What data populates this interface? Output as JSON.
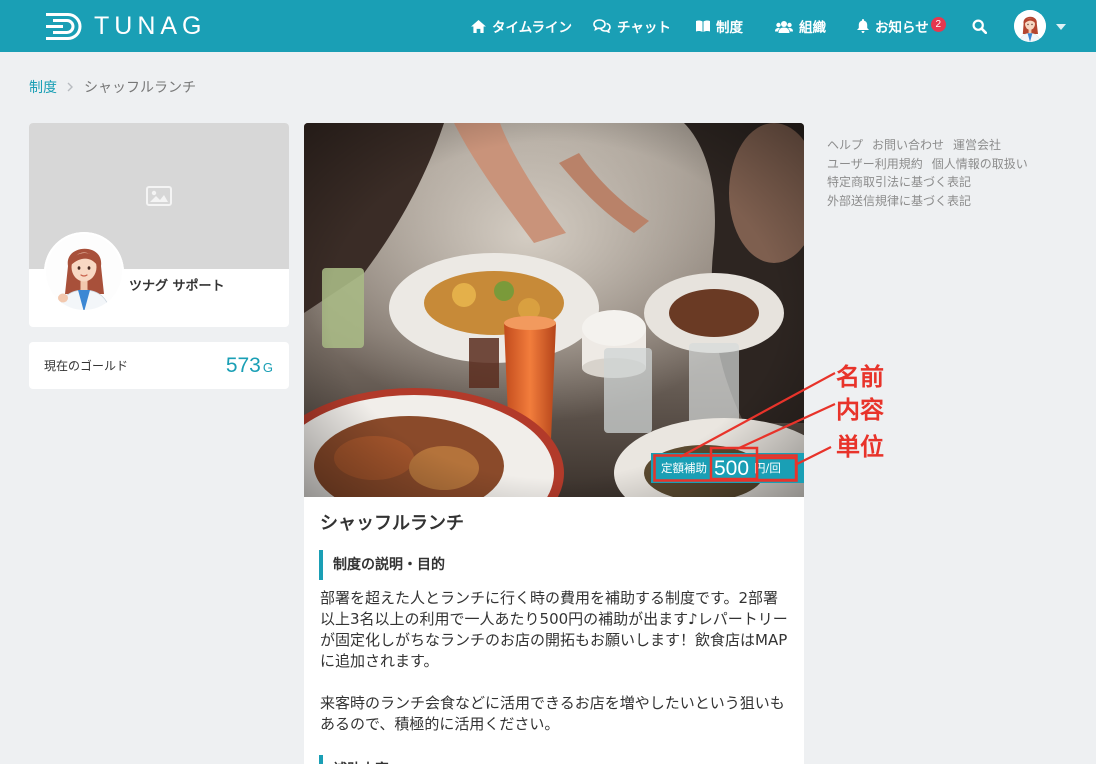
{
  "header": {
    "logo": {
      "icon": "tunag-logo-mark-icon",
      "text": "TUNAG"
    },
    "nav": [
      {
        "label": "タイムライン",
        "icon": "home-icon"
      },
      {
        "label": "チャット",
        "icon": "chat-icon"
      },
      {
        "label": "制度",
        "icon": "book-icon"
      },
      {
        "label": "組織",
        "icon": "users-icon"
      },
      {
        "label": "お知らせ",
        "icon": "bell-icon",
        "badge": "2"
      }
    ],
    "search_icon": "search-icon",
    "account": {
      "avatar": "user-avatar",
      "menu_icon": "caret-down-icon"
    }
  },
  "breadcrumb": [
    {
      "label": "制度",
      "link": true
    },
    {
      "label": "シャッフルランチ",
      "link": false
    }
  ],
  "profile_card": {
    "cover_icon": "image-placeholder-icon",
    "name": "ツナグ サポート"
  },
  "gold_card": {
    "label": "現在のゴールド",
    "value": "573",
    "unit": "G"
  },
  "system_detail": {
    "title": "シャッフルランチ",
    "benefit_badge": {
      "name": "定額補助",
      "amount": "500",
      "unit": "円/回"
    },
    "sections": [
      {
        "heading": "制度の説明・目的",
        "paragraphs": [
          "部署を超えた人とランチに行く時の費用を補助する制度です。2部署以上3名以上の利用で一人あたり500円の補助が出ます♪レパートリーが固定化しがちなランチのお店の開拓もお願いします！飲食店はMAPに追加されます。",
          "来客時のランチ会食などに活用できるお店を増やしたいという狙いもあるので、積極的に活用ください。"
        ]
      },
      {
        "heading": "補助内容"
      }
    ]
  },
  "annotations": {
    "name_label": "名前",
    "content_label": "内容",
    "unit_label": "単位"
  },
  "footer_links": [
    [
      "ヘルプ",
      "お問い合わせ",
      "運営会社"
    ],
    [
      "ユーザー利用規約",
      "個人情報の取扱い"
    ],
    [
      "特定商取引法に基づく表記"
    ],
    [
      "外部送信規律に基づく表記"
    ]
  ],
  "colors": {
    "primary": "#1a9fb5",
    "background": "#eef0f2",
    "notification_badge": "#e6384f",
    "annotation": "#e8332a",
    "text": "#333333",
    "link_muted": "#8c8c8c"
  }
}
